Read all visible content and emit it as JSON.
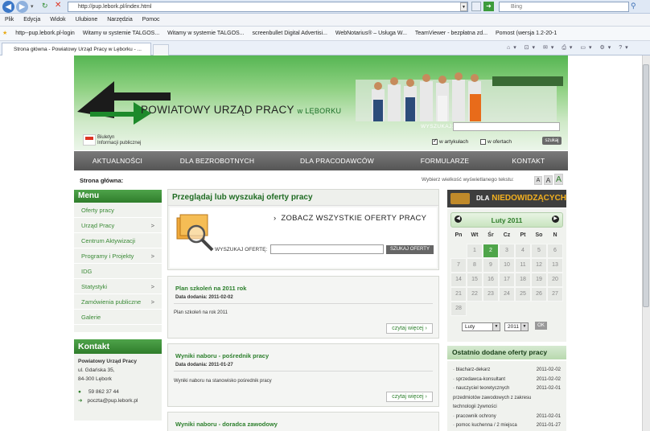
{
  "browser": {
    "url": "http://pup.lebork.pl/index.html",
    "search_placeholder": "Bing",
    "menu": [
      "Plik",
      "Edycja",
      "Widok",
      "Ulubione",
      "Narzędzia",
      "Pomoc"
    ],
    "favorites": [
      "http--pup.lebork.pl-login",
      "Witamy w systemie TALGOS...",
      "Witamy w systemie TALGOS...",
      "screenbullet Digital Advertisi...",
      "WebNotarius® – Usługa W...",
      "TeamViewer - bezpłatna zd...",
      "Pomost (wersja 1.2-20-1"
    ],
    "tab_title": "Strona główna - Powiatowy Urząd Pracy w Lęborku - ..."
  },
  "header": {
    "title": "POWIATOWY URZĄD PRACY",
    "title_suffix": "w LĘBORKU",
    "search_label": "WYSZUKAJ:",
    "search_value": "",
    "bip_line1": "Biuletyn",
    "bip_line2": "Informacji publicznej",
    "opt_articles": "w artykułach",
    "opt_offers": "w ofertach",
    "search_button": "szukaj"
  },
  "nav": [
    "AKTUALNOŚCI",
    "DLA BEZROBOTNYCH",
    "DLA PRACODAWCÓW",
    "FORMULARZE",
    "KONTAKT"
  ],
  "breadcrumb": "Strona główna:",
  "font_size_label": "Wybierz wielkość wyświetlanego tekstu:",
  "font_sizes": [
    "A",
    "A",
    "A"
  ],
  "menu": {
    "title": "Menu",
    "items": [
      {
        "label": "Oferty pracy",
        "arrow": ""
      },
      {
        "label": "Urząd Pracy",
        "arrow": ">"
      },
      {
        "label": "Centrum Aktywizacji",
        "arrow": ""
      },
      {
        "label": "Programy i Projekty",
        "arrow": ">"
      },
      {
        "label": "IDG",
        "arrow": ""
      },
      {
        "label": "Statystyki",
        "arrow": ">"
      },
      {
        "label": "Zamówienia publiczne",
        "arrow": ">"
      },
      {
        "label": "Galerie",
        "arrow": ""
      }
    ]
  },
  "kontakt": {
    "title": "Kontakt",
    "name": "Powiatowy Urząd Pracy",
    "street": "ul. Gdańska 35,",
    "city": "84-300 Lębork",
    "phone": "59 862 37 44",
    "email": "poczta@pup.lebork.pl"
  },
  "offers": {
    "title": "Przeglądaj lub wyszukaj oferty pracy",
    "see_all": "ZOBACZ WSZYSTKIE OFERTY PRACY",
    "search_label": "WYSZUKAJ OFERTĘ:",
    "search_button": "SZUKAJ OFERTY"
  },
  "news": [
    {
      "title": "Plan szkoleń na 2011 rok",
      "date": "Data dodania: 2011-02-02",
      "body": "Plan szkoleń na rok 2011",
      "more": "czytaj więcej"
    },
    {
      "title": "Wyniki naboru - pośrednik pracy",
      "date": "Data dodania: 2011-01-27",
      "body": "Wyniki naboru na stanowisko pośrednik pracy",
      "more": "czytaj więcej"
    },
    {
      "title": "Wyniki naboru - doradca zawodowy"
    }
  ],
  "accessibility": {
    "prefix": "DLA",
    "label": "NIEDOWIDZĄCYCH"
  },
  "calendar": {
    "title": "Luty 2011",
    "weekdays": [
      "Pn",
      "Wt",
      "Śr",
      "Cz",
      "Pt",
      "So",
      "N"
    ],
    "weeks": [
      [
        "",
        "1",
        "2",
        "3",
        "4",
        "5",
        "6"
      ],
      [
        "7",
        "8",
        "9",
        "10",
        "11",
        "12",
        "13"
      ],
      [
        "14",
        "15",
        "16",
        "17",
        "18",
        "19",
        "20"
      ],
      [
        "21",
        "22",
        "23",
        "24",
        "25",
        "26",
        "27"
      ],
      [
        "28",
        "",
        "",
        "",
        "",
        "",
        ""
      ]
    ],
    "today": "2",
    "month_select": "Luty",
    "year_select": "2011",
    "ok": "OK"
  },
  "recent": {
    "title": "Ostatnio dodane oferty pracy",
    "items": [
      {
        "name": "blacharz-dekarz",
        "date": "2011-02-02"
      },
      {
        "name": "sprzedawca-konsultant",
        "date": "2011-02-02"
      },
      {
        "name": "nauczyciel teoretycznych",
        "date": "2011-02-01"
      },
      {
        "name": "przedmiotów zawodowych z zakresu",
        "date": ""
      },
      {
        "name": "technologii żywności",
        "date": ""
      },
      {
        "name": "pracownik ochrony",
        "date": "2011-02-01"
      },
      {
        "name": "pomoc kuchenna / 2 miejsca",
        "date": "2011-01-27"
      }
    ]
  },
  "colors": {
    "green": "#2f7d2b",
    "nav": "#5a5a5a",
    "orange": "#f3b01f"
  }
}
